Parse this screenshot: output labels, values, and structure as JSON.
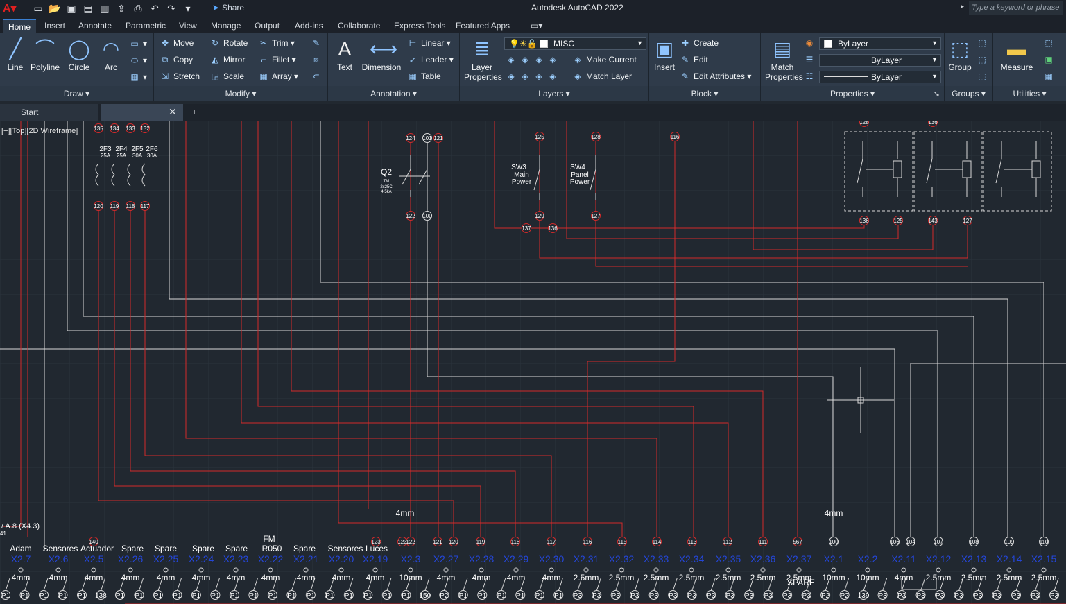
{
  "app": {
    "title": "Autodesk AutoCAD 2022",
    "share_label": "Share",
    "search_placeholder": "Type a keyword or phrase"
  },
  "tabs": [
    "Home",
    "Insert",
    "Annotate",
    "Parametric",
    "View",
    "Manage",
    "Output",
    "Add-ins",
    "Collaborate",
    "Express Tools",
    "Featured Apps"
  ],
  "ribbon": {
    "draw": {
      "title": "Draw",
      "line": "Line",
      "polyline": "Polyline",
      "circle": "Circle",
      "arc": "Arc"
    },
    "modify": {
      "title": "Modify",
      "move": "Move",
      "rotate": "Rotate",
      "trim": "Trim",
      "copy": "Copy",
      "mirror": "Mirror",
      "fillet": "Fillet",
      "stretch": "Stretch",
      "scale": "Scale",
      "array": "Array"
    },
    "annotation": {
      "title": "Annotation",
      "text": "Text",
      "dimension": "Dimension",
      "linear": "Linear",
      "leader": "Leader",
      "table": "Table"
    },
    "layers": {
      "title": "Layers",
      "layer_properties": "Layer Properties",
      "current_layer": "MISC",
      "make_current": "Make Current",
      "match_layer": "Match Layer"
    },
    "block": {
      "title": "Block",
      "insert": "Insert",
      "create": "Create",
      "edit": "Edit",
      "edit_attributes": "Edit Attributes"
    },
    "properties": {
      "title": "Properties",
      "match_properties": "Match Properties",
      "color": "ByLayer",
      "linetype": "ByLayer",
      "lineweight": "ByLayer"
    },
    "groups": {
      "title": "Groups",
      "group": "Group"
    },
    "utilities": {
      "title": "Utilities",
      "measure": "Measure"
    }
  },
  "doc_tabs": {
    "start": "Start"
  },
  "viewport": {
    "label": "[−][Top][2D Wireframe]"
  },
  "drawing": {
    "fuse_labels": [
      "2F3",
      "2F4",
      "2F5",
      "2F6"
    ],
    "fuse_ratings": [
      "25A",
      "25A",
      "30A",
      "30A"
    ],
    "fuse_top_nodes": [
      "135",
      "134",
      "133",
      "132"
    ],
    "fuse_bottom_nodes": [
      "120",
      "119",
      "118",
      "117"
    ],
    "q2": {
      "label": "Q2",
      "sub1": "TM",
      "sub2": "2x25C",
      "sub3": "4,5kA",
      "nodes": [
        "124",
        "101",
        "121",
        "122",
        "100"
      ]
    },
    "sw3": {
      "label1": "SW3",
      "label2": "Main",
      "label3": "Power",
      "top": "125",
      "bottom": "129"
    },
    "sw4": {
      "label1": "SW4",
      "label2": "Panel",
      "label3": "Power",
      "top": "128",
      "bottom": "127"
    },
    "node_116": "116",
    "node_137": "137",
    "node_136": "136",
    "relay_nodes_bottom": [
      "136",
      "125",
      "143",
      "127"
    ],
    "relay_nodes_top": [
      "128",
      "136"
    ],
    "wire_size_a": "4mm",
    "wire_size_b": "4mm",
    "left_ref": "/ A.8 (X4.3)",
    "left_ref_node": "41",
    "terminal_nodes": [
      "140",
      "123",
      "123",
      "122",
      "121",
      "120",
      "119",
      "118",
      "117",
      "116",
      "115",
      "114",
      "113",
      "112",
      "111",
      "567",
      "100",
      "106",
      "104",
      "107",
      "108",
      "109",
      "110"
    ],
    "terminal_labels": [
      "Adam",
      "Sensores",
      "Actuador",
      "Spare",
      "Spare",
      "Spare",
      "Spare",
      "FM R050",
      "Spare",
      "Sensores",
      "Luces"
    ],
    "terminal_ids": [
      "X2.7",
      "X2.6",
      "X2.5",
      "X2.26",
      "X2.25",
      "X2.24",
      "X2.23",
      "X2.22",
      "X2.21",
      "X2.20",
      "X2.19",
      "X2.3",
      "X2.27",
      "X2.28",
      "X2.29",
      "X2.30",
      "X2.31",
      "X2.32",
      "X2.33",
      "X2.34",
      "X2.35",
      "X2.36",
      "X2.37",
      "X2.1",
      "X2.2",
      "X2.11",
      "X2.12",
      "X2.13",
      "X2.14",
      "X2.15"
    ],
    "wire_sizes": [
      "4mm",
      "4mm",
      "4mm",
      "4mm",
      "4mm",
      "4mm",
      "4mm",
      "4mm",
      "4mm",
      "4mm",
      "4mm",
      "10mm",
      "4mm",
      "4mm",
      "4mm",
      "4mm",
      "2.5mm",
      "2.5mm",
      "2.5mm",
      "2.5mm",
      "2.5mm",
      "2.5mm",
      "2.5mm",
      "10mm",
      "10mm",
      "4mm",
      "2.5mm",
      "2.5mm",
      "2.5mm",
      "2.5mm"
    ],
    "spare_note": "SPARE",
    "bottom_nodes": [
      "P1",
      "P1",
      "P1",
      "P1",
      "P1",
      "138",
      "P1",
      "P1",
      "P1",
      "P1",
      "P1",
      "P1",
      "P1",
      "P1",
      "P1",
      "P1",
      "P1",
      "P1",
      "P1",
      "P1",
      "P1",
      "P1",
      "150",
      "P2",
      "P1",
      "P1",
      "P1",
      "P1",
      "P1",
      "P1",
      "P3",
      "P3",
      "P3",
      "P3",
      "P3",
      "P3",
      "P3",
      "P3",
      "P3",
      "P3",
      "P3",
      "P3",
      "P3",
      "P2",
      "P2",
      "139",
      "P3",
      "P3",
      "P3",
      "P3",
      "P3",
      "P3",
      "P3",
      "P3",
      "P3",
      "P3"
    ]
  }
}
